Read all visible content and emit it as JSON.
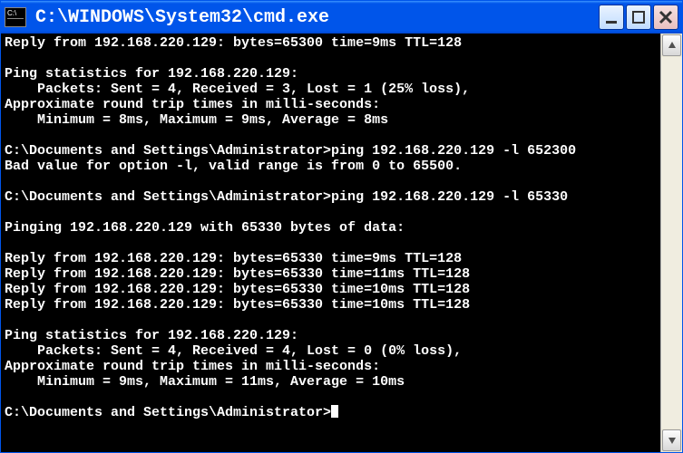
{
  "window": {
    "icon_text": "C:\\",
    "title": "C:\\WINDOWS\\System32\\cmd.exe"
  },
  "terminal": {
    "lines": [
      "Reply from 192.168.220.129: bytes=65300 time=9ms TTL=128",
      "",
      "Ping statistics for 192.168.220.129:",
      "    Packets: Sent = 4, Received = 3, Lost = 1 (25% loss),",
      "Approximate round trip times in milli-seconds:",
      "    Minimum = 8ms, Maximum = 9ms, Average = 8ms",
      "",
      "C:\\Documents and Settings\\Administrator>ping 192.168.220.129 -l 652300",
      "Bad value for option -l, valid range is from 0 to 65500.",
      "",
      "C:\\Documents and Settings\\Administrator>ping 192.168.220.129 -l 65330",
      "",
      "Pinging 192.168.220.129 with 65330 bytes of data:",
      "",
      "Reply from 192.168.220.129: bytes=65330 time=9ms TTL=128",
      "Reply from 192.168.220.129: bytes=65330 time=11ms TTL=128",
      "Reply from 192.168.220.129: bytes=65330 time=10ms TTL=128",
      "Reply from 192.168.220.129: bytes=65330 time=10ms TTL=128",
      "",
      "Ping statistics for 192.168.220.129:",
      "    Packets: Sent = 4, Received = 4, Lost = 0 (0% loss),",
      "Approximate round trip times in milli-seconds:",
      "    Minimum = 9ms, Maximum = 11ms, Average = 10ms",
      ""
    ],
    "prompt": "C:\\Documents and Settings\\Administrator>"
  }
}
